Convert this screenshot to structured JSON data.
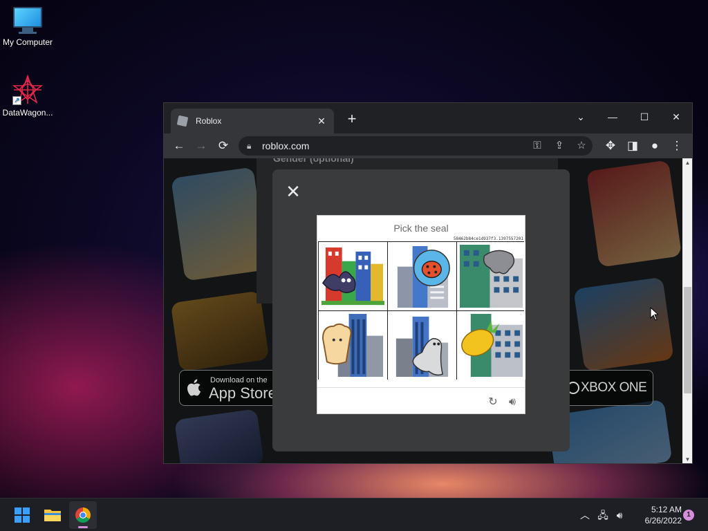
{
  "desktop": {
    "icons": [
      {
        "label": "My Computer",
        "icon": "monitor-icon"
      },
      {
        "label": "DataWagon...",
        "icon": "datawagon-logo-icon"
      }
    ]
  },
  "browser": {
    "tab_title": "Roblox",
    "new_tab_symbol": "+",
    "url": "roblox.com",
    "controls": {
      "dropdown": "⌄",
      "minimize": "—",
      "maximize": "☐",
      "close": "✕"
    },
    "page": {
      "gender_label": "Gender (optional)",
      "app_store_small": "Download on the",
      "app_store_big": "App Store",
      "xbox_label": "XBOX ONE"
    }
  },
  "captcha": {
    "title": "Pick the seal",
    "token": "58462b84ce1d937f3.1397557201",
    "tiles": [
      {
        "subject": "bat",
        "icon": "bat-on-buildings-icon"
      },
      {
        "subject": "ladybug",
        "icon": "ladybug-on-buildings-icon"
      },
      {
        "subject": "elephant",
        "icon": "elephant-on-building-icon"
      },
      {
        "subject": "bread",
        "icon": "bread-on-buildings-icon"
      },
      {
        "subject": "seal",
        "icon": "seal-on-buildings-icon"
      },
      {
        "subject": "pineapple",
        "icon": "pineapple-on-building-icon"
      }
    ]
  },
  "taskbar": {
    "time": "5:12 AM",
    "date": "6/26/2022",
    "notification_count": "1",
    "accent": "#d48fd9"
  }
}
